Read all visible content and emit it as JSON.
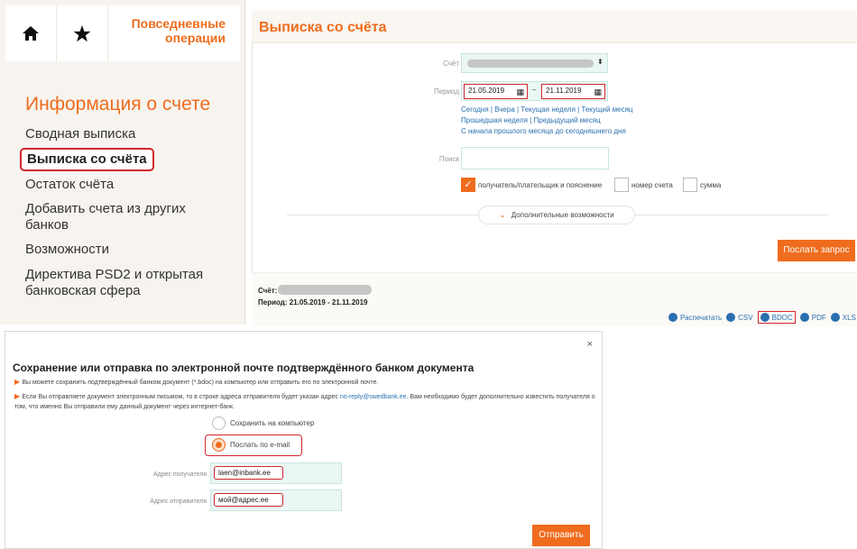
{
  "nav": {
    "daily_ops": "Повседневные операции",
    "section_title": "Информация о счете",
    "items": [
      "Сводная выписка",
      "Выписка со счёта",
      "Остаток счёта",
      "Добавить счета из других банков",
      "Возможности",
      "Директива PSD2 и открытая банковская сфера"
    ]
  },
  "main": {
    "title": "Выписка со счёта",
    "account_label": "Счёт",
    "period_label": "Период",
    "date_from": "21.05.2019",
    "date_to": "21.11.2019",
    "dash": "–",
    "quick_links": [
      "Сегодня | Вчера | Текущая неделя | Текущий месяц",
      "Прошедшая неделя | Предыдущий месяц",
      "С начала прошлого месяца до сегодняшнего дня"
    ],
    "search_label": "Поиск",
    "filters": [
      {
        "label": "получатель/плательщик и пояснение",
        "checked": true
      },
      {
        "label": "номер счета",
        "checked": false
      },
      {
        "label": "сумма",
        "checked": false
      }
    ],
    "more_options": "Дополнительные возможности",
    "submit": "Послать запрос",
    "summary_account": "Счёт:",
    "summary_period": "Период: 21.05.2019 - 21.11.2019",
    "exports": [
      "Распечатать",
      "CSV",
      "BDOC",
      "PDF",
      "XLS"
    ]
  },
  "modal": {
    "close": "×",
    "title": "Сохранение или отправка по электронной почте подтверждённого банком документа",
    "info1": "Вы можете сохранить подтверждённый банком документ (*.bdoc) на компьютер или отправить его по электронной почте.",
    "info2_a": "Если Вы отправляете документ электронным письмом, то в строке адреса отправителя будет указан адрес ",
    "info2_link": "no-reply@swedbank.ee",
    "info2_b": ". Вам необходимо будет дополнительно известить получателя о том, что именно Вы отправили ему данный документ через интернет-банк.",
    "option_save": "Сохранить на компьютер",
    "option_email": "Послать по e-mail",
    "recipient_label": "Адрес получателя",
    "recipient_value": "laen@inbank.ee",
    "sender_label": "Адрес отправителя",
    "sender_value": "мой@адрес.ee",
    "send": "Отправить"
  },
  "colors": {
    "accent": "#ef6c1e",
    "highlight": "#d1262d",
    "link": "#2a6fb0"
  }
}
